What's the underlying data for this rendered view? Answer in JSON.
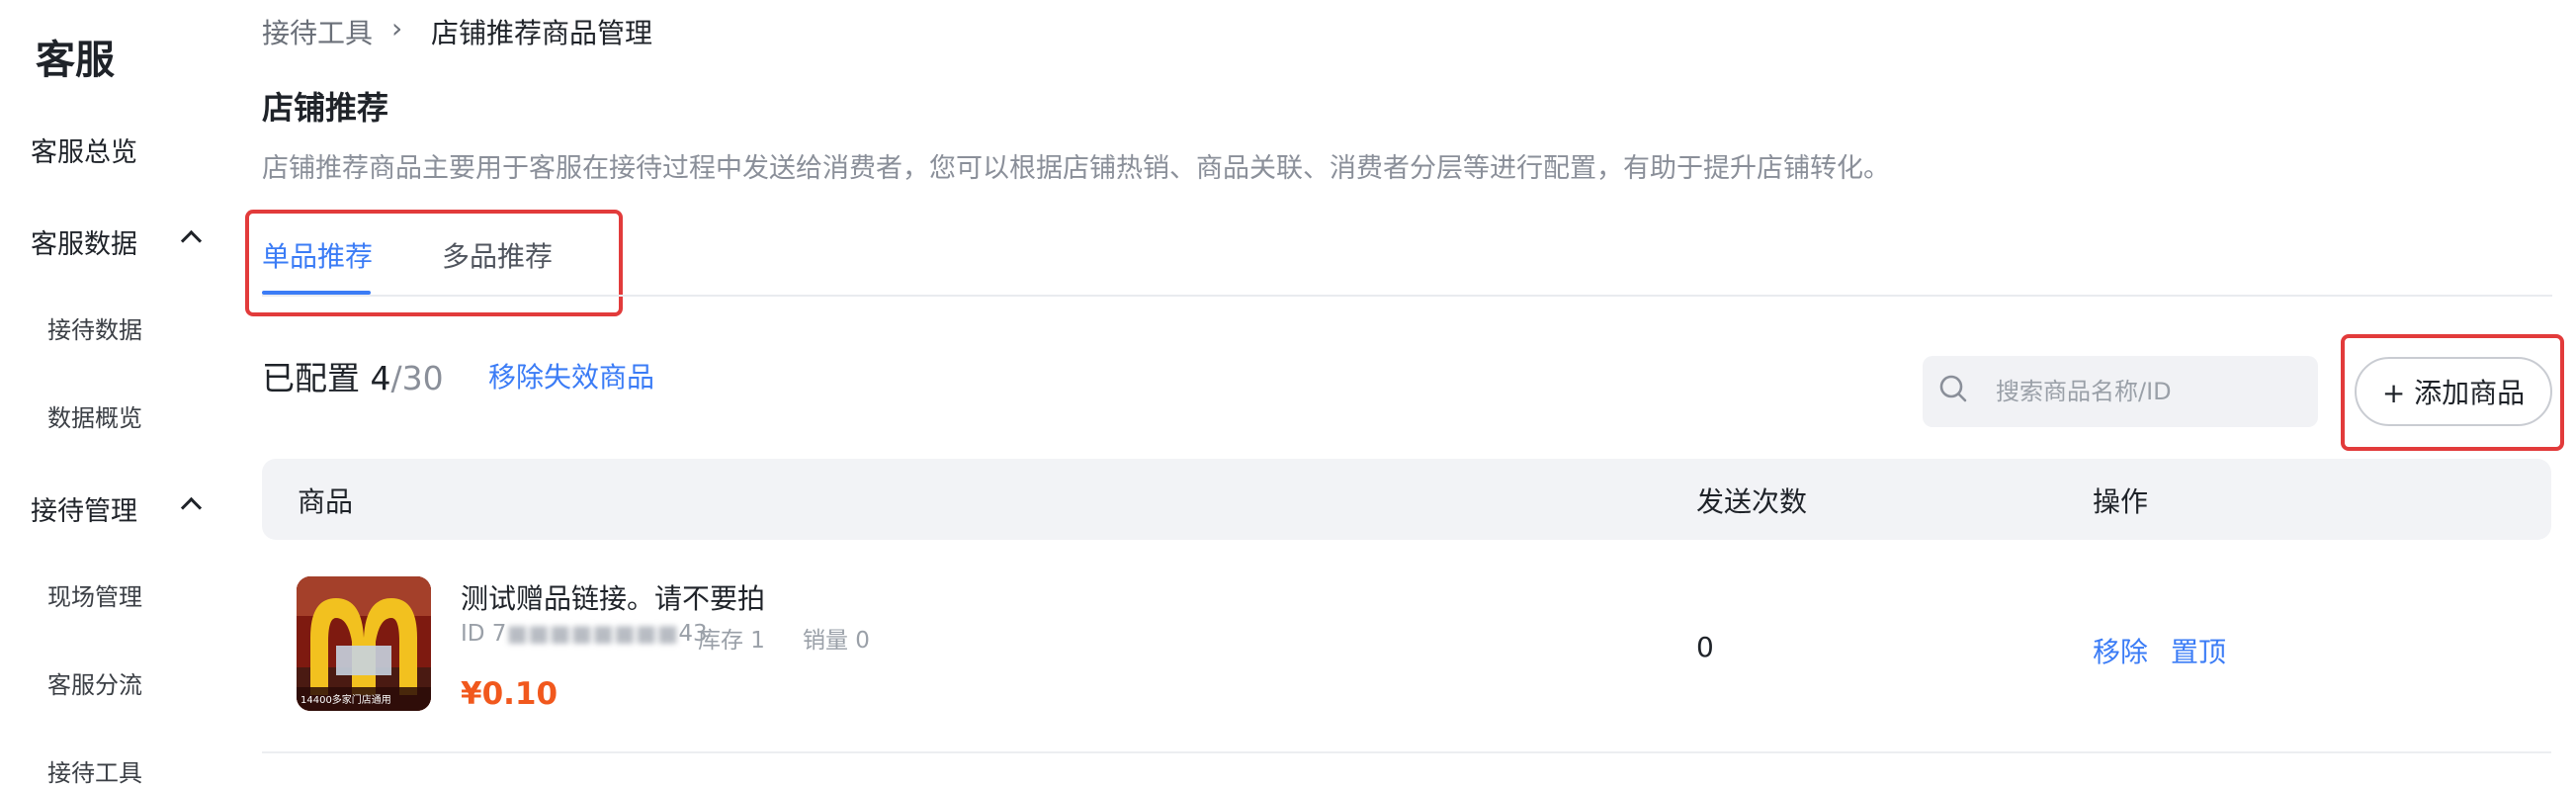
{
  "sidebar": {
    "title": "客服",
    "items": [
      {
        "label": "客服总览"
      },
      {
        "label": "客服数据"
      },
      {
        "label": "接待数据"
      },
      {
        "label": "数据概览"
      },
      {
        "label": "接待管理"
      },
      {
        "label": "现场管理"
      },
      {
        "label": "客服分流"
      },
      {
        "label": "接待工具"
      }
    ]
  },
  "breadcrumb": {
    "parent": "接待工具",
    "separator": "›",
    "current": "店铺推荐商品管理"
  },
  "page": {
    "title": "店铺推荐",
    "description": "店铺推荐商品主要用于客服在接待过程中发送给消费者，您可以根据店铺热销、商品关联、消费者分层等进行配置，有助于提升店铺转化。"
  },
  "tabs": [
    {
      "label": "单品推荐",
      "active": true
    },
    {
      "label": "多品推荐",
      "active": false
    }
  ],
  "toolbar": {
    "configured_label": "已配置",
    "configured_count": "4",
    "configured_total": "/30",
    "remove_invalid_label": "移除失效商品",
    "search_placeholder": "搜索商品名称/ID",
    "add_button_label": "+ 添加商品"
  },
  "table": {
    "headers": [
      "商品",
      "发送次数",
      "操作"
    ],
    "rows": [
      {
        "name": "测试赠品链接。请不要拍",
        "id_prefix": "ID 7",
        "id_suffix": "43",
        "stock": "库存 1",
        "sales": "销量 0",
        "price": "¥0.10",
        "send_count": "0",
        "action_remove": "移除",
        "action_pin": "置顶",
        "thumb_caption": "14400多家门店通用"
      }
    ]
  },
  "colors": {
    "accent": "#3b7cf6",
    "price": "#f1581d",
    "highlight_box": "#e23b3b"
  }
}
